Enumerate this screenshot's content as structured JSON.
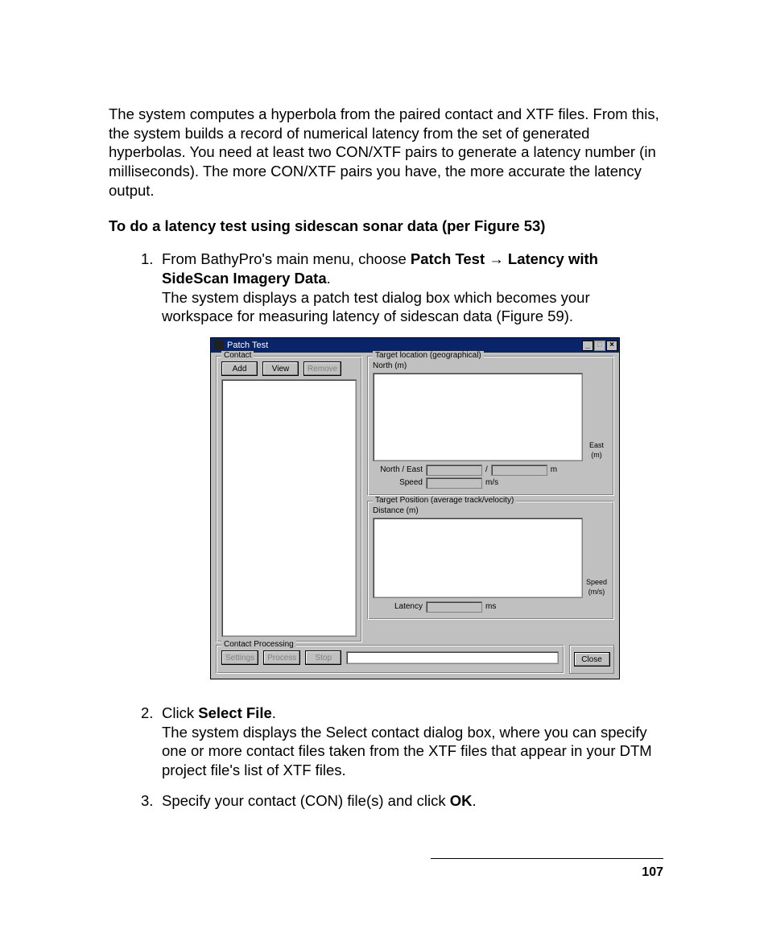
{
  "intro_para": "The system computes a hyperbola from the paired contact and XTF files. From this, the system builds a record of numerical latency from the set of generated hyperbolas. You need at least two CON/XTF pairs to generate a latency number (in milliseconds). The more CON/XTF pairs you have, the more accurate the latency output.",
  "heading": "To do a latency test using sidescan sonar data (per Figure 53)",
  "step1": {
    "num": "1.",
    "prefix": "From BathyPro's main menu, choose ",
    "bold1": "Patch Test ",
    "arrow": "→",
    "bold2": " Latency with SideScan Imagery Data",
    "period": ".",
    "body2": "The system displays a patch test dialog box which becomes your workspace for measuring latency of sidescan data (Figure 59)."
  },
  "dialog": {
    "title": "Patch Test",
    "contact": {
      "legend": "Contact",
      "add": "Add",
      "view": "View",
      "remove": "Remove"
    },
    "target_geo": {
      "legend": "Target location (geographical)",
      "y_label": "North (m)",
      "x_label_right1": "East",
      "x_label_right2": "(m)",
      "ne_label": "North / East",
      "ne_sep": "/",
      "ne_unit": "m",
      "speed_label": "Speed",
      "speed_unit": "m/s"
    },
    "target_avg": {
      "legend": "Target Position (average track/velocity)",
      "y_label": "Distance (m)",
      "x_label_right1": "Speed",
      "x_label_right2": "(m/s)",
      "lat_label": "Latency",
      "lat_unit": "ms"
    },
    "proc": {
      "legend": "Contact Processing",
      "settings": "Settings",
      "process": "Process",
      "stop": "Stop"
    },
    "close": "Close"
  },
  "step2": {
    "num": "2.",
    "line1a": "Click ",
    "bold1": "Select File",
    "line1b": ".",
    "body": "The system displays the Select contact dialog box, where you can specify one or more contact files taken from the XTF files that appear in your DTM project file's list of XTF files."
  },
  "step3": {
    "num": "3.",
    "line_a": "Specify your contact (CON) file(s) and click ",
    "bold": "OK",
    "line_b": "."
  },
  "page_number": "107"
}
